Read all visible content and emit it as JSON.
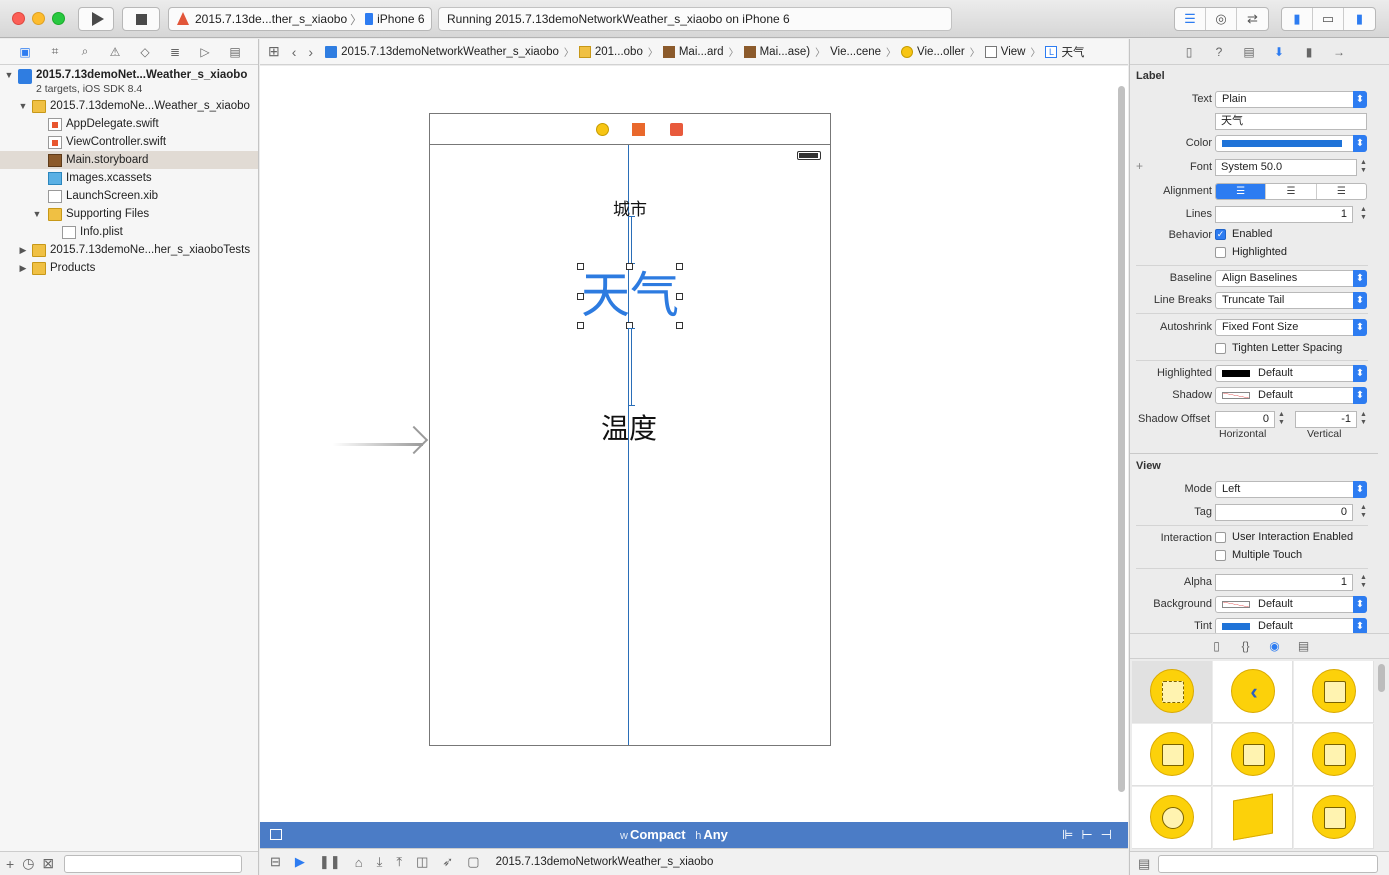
{
  "toolbar": {
    "scheme_name": "2015.7.13de...ther_s_xiaobo",
    "scheme_device": "iPhone 6",
    "activity_text": "Running 2015.7.13demoNetworkWeather_s_xiaobo on iPhone 6"
  },
  "navigator": {
    "project_name": "2015.7.13demoNet...Weather_s_xiaobo",
    "project_sub": "2 targets, iOS SDK 8.4",
    "group_main": "2015.7.13demoNe...Weather_s_xiaobo",
    "files": [
      "AppDelegate.swift",
      "ViewController.swift",
      "Main.storyboard",
      "Images.xcassets",
      "LaunchScreen.xib"
    ],
    "supporting_files": "Supporting Files",
    "info_plist": "Info.plist",
    "group_tests": "2015.7.13demoNe...her_s_xiaoboTests",
    "products": "Products"
  },
  "jumpbar": {
    "crumbs": [
      "2015.7.13demoNetworkWeather_s_xiaobo",
      "201...obo",
      "Mai...ard",
      "Mai...ase)",
      "Vie...cene",
      "Vie...oller",
      "View",
      "天气"
    ],
    "label_glyph": "L"
  },
  "canvas": {
    "label_city": "城市",
    "label_weather": "天气",
    "label_temp": "温度",
    "size_class_w_prefix": "w",
    "size_class_w": "Compact",
    "size_class_h_prefix": "h",
    "size_class_h": "Any",
    "debug_target": "2015.7.13demoNetworkWeather_s_xiaobo"
  },
  "inspector": {
    "label_section": "Label",
    "text_label": "Text",
    "text_type": "Plain",
    "text_value": "天气",
    "color_label": "Color",
    "font_label": "Font",
    "font_value": "System 50.0",
    "font_plus": "+",
    "alignment_label": "Alignment",
    "lines_label": "Lines",
    "lines_value": "1",
    "behavior_label": "Behavior",
    "enabled_label": "Enabled",
    "highlighted_check_label": "Highlighted",
    "baseline_label": "Baseline",
    "baseline_value": "Align Baselines",
    "linebreaks_label": "Line Breaks",
    "linebreaks_value": "Truncate Tail",
    "autoshrink_label": "Autoshrink",
    "autoshrink_value": "Fixed Font Size",
    "tighten_label": "Tighten Letter Spacing",
    "highlighted_label": "Highlighted",
    "highlighted_value": "Default",
    "shadow_label": "Shadow",
    "shadow_value": "Default",
    "shadow_offset_label": "Shadow Offset",
    "shadow_h": "0",
    "shadow_v": "-1",
    "horizontal_label": "Horizontal",
    "vertical_label": "Vertical",
    "view_section": "View",
    "mode_label": "Mode",
    "mode_value": "Left",
    "tag_label": "Tag",
    "tag_value": "0",
    "interaction_label": "Interaction",
    "user_interaction_label": "User Interaction Enabled",
    "multiple_touch_label": "Multiple Touch",
    "alpha_label": "Alpha",
    "alpha_value": "1",
    "background_label": "Background",
    "background_value": "Default",
    "tint_label": "Tint",
    "tint_value": "Default"
  },
  "colors": {
    "accent": "#2d7cf1",
    "label_text": "#2d7be0",
    "size_bar": "#4b7cc6",
    "guide": "#2a6eb8"
  }
}
